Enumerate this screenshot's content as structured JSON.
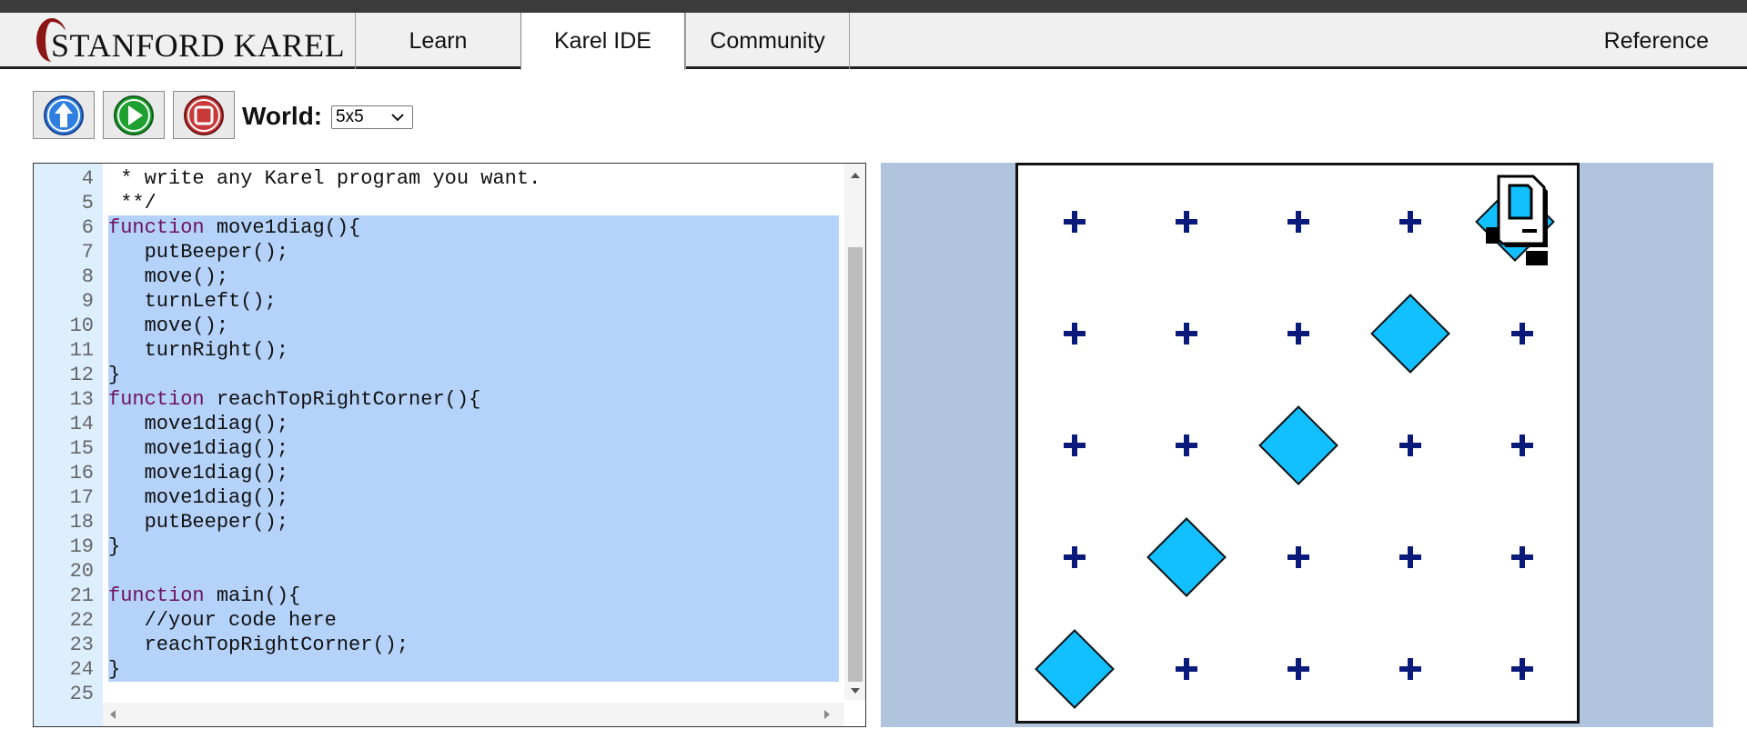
{
  "nav": {
    "logo_text": "STANFORD KAREL",
    "tabs": [
      "Learn",
      "Karel IDE",
      "Community"
    ],
    "active_tab": "Karel IDE",
    "reference": "Reference"
  },
  "toolbar": {
    "world_label": "World:",
    "world_value": "5x5"
  },
  "editor": {
    "lines": [
      {
        "n": "4",
        "code": " * write any Karel program you want.",
        "style": "comment",
        "selected": false
      },
      {
        "n": "5",
        "code": " **/",
        "style": "comment",
        "selected": false
      },
      {
        "n": "6",
        "kw": "function",
        "rest": " move1diag(){",
        "selected": true
      },
      {
        "n": "7",
        "code": "   putBeeper();",
        "selected": true
      },
      {
        "n": "8",
        "code": "   move();",
        "selected": true
      },
      {
        "n": "9",
        "code": "   turnLeft();",
        "selected": true
      },
      {
        "n": "10",
        "code": "   move();",
        "selected": true
      },
      {
        "n": "11",
        "code": "   turnRight();",
        "selected": true
      },
      {
        "n": "12",
        "code": "}",
        "selected": true
      },
      {
        "n": "13",
        "kw": "function",
        "rest": " reachTopRightCorner(){",
        "selected": true
      },
      {
        "n": "14",
        "code": "   move1diag();",
        "selected": true
      },
      {
        "n": "15",
        "code": "   move1diag();",
        "selected": true
      },
      {
        "n": "16",
        "code": "   move1diag();",
        "selected": true
      },
      {
        "n": "17",
        "code": "   move1diag();",
        "selected": true
      },
      {
        "n": "18",
        "code": "   putBeeper();",
        "selected": true
      },
      {
        "n": "19",
        "code": "}",
        "selected": true
      },
      {
        "n": "20",
        "code": "",
        "selected": true
      },
      {
        "n": "21",
        "kw": "function",
        "rest": " main(){",
        "selected": true
      },
      {
        "n": "22",
        "code": "   //your code here",
        "style": "green",
        "selected": true
      },
      {
        "n": "23",
        "code": "   reachTopRightCorner();",
        "selected": true
      },
      {
        "n": "24",
        "code": "}",
        "selected": true
      },
      {
        "n": "25",
        "code": "",
        "selected": false
      }
    ]
  },
  "world": {
    "size": "5x5",
    "beepers": [
      [
        1,
        1
      ],
      [
        2,
        2
      ],
      [
        3,
        3
      ],
      [
        4,
        4
      ],
      [
        5,
        5
      ]
    ],
    "karel": {
      "col": 5,
      "row": 5,
      "facing": "east"
    },
    "colors": {
      "beeper": "#12c0ff",
      "corner": "#0a1a7a",
      "bg": "#b0c4de"
    }
  }
}
